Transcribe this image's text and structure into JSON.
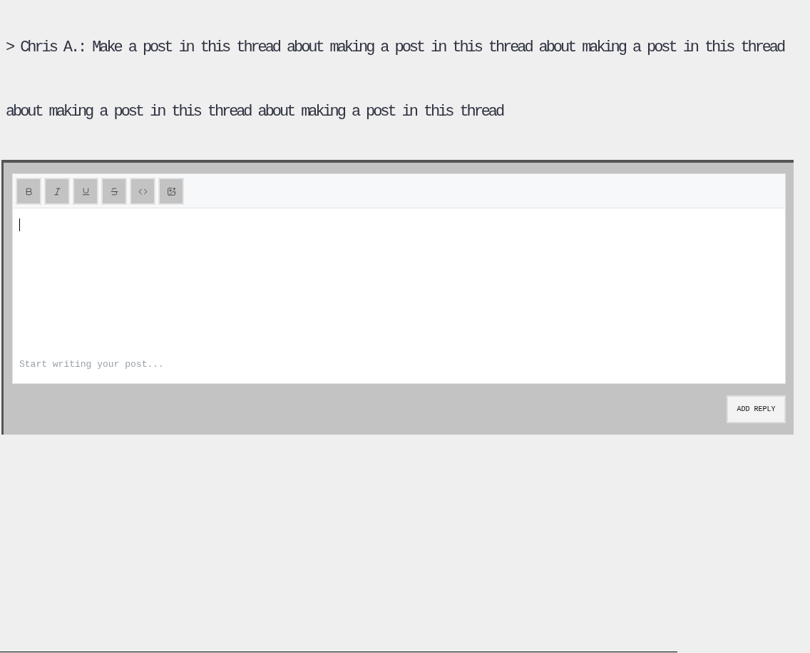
{
  "quote": {
    "marker": ">",
    "author": "Chris A.:",
    "text": "Make a post in this thread about making a post in this thread about making a post in this thread about making a post in this thread about making a post in this thread"
  },
  "editor": {
    "toolbar": [
      {
        "kind": "bold"
      },
      {
        "kind": "italic"
      },
      {
        "kind": "underline"
      },
      {
        "kind": "strike"
      },
      {
        "kind": "code"
      },
      {
        "kind": "image"
      }
    ],
    "focused": true,
    "placeholder": "Start writing your post..."
  },
  "submit_button": "ADD REPLY"
}
